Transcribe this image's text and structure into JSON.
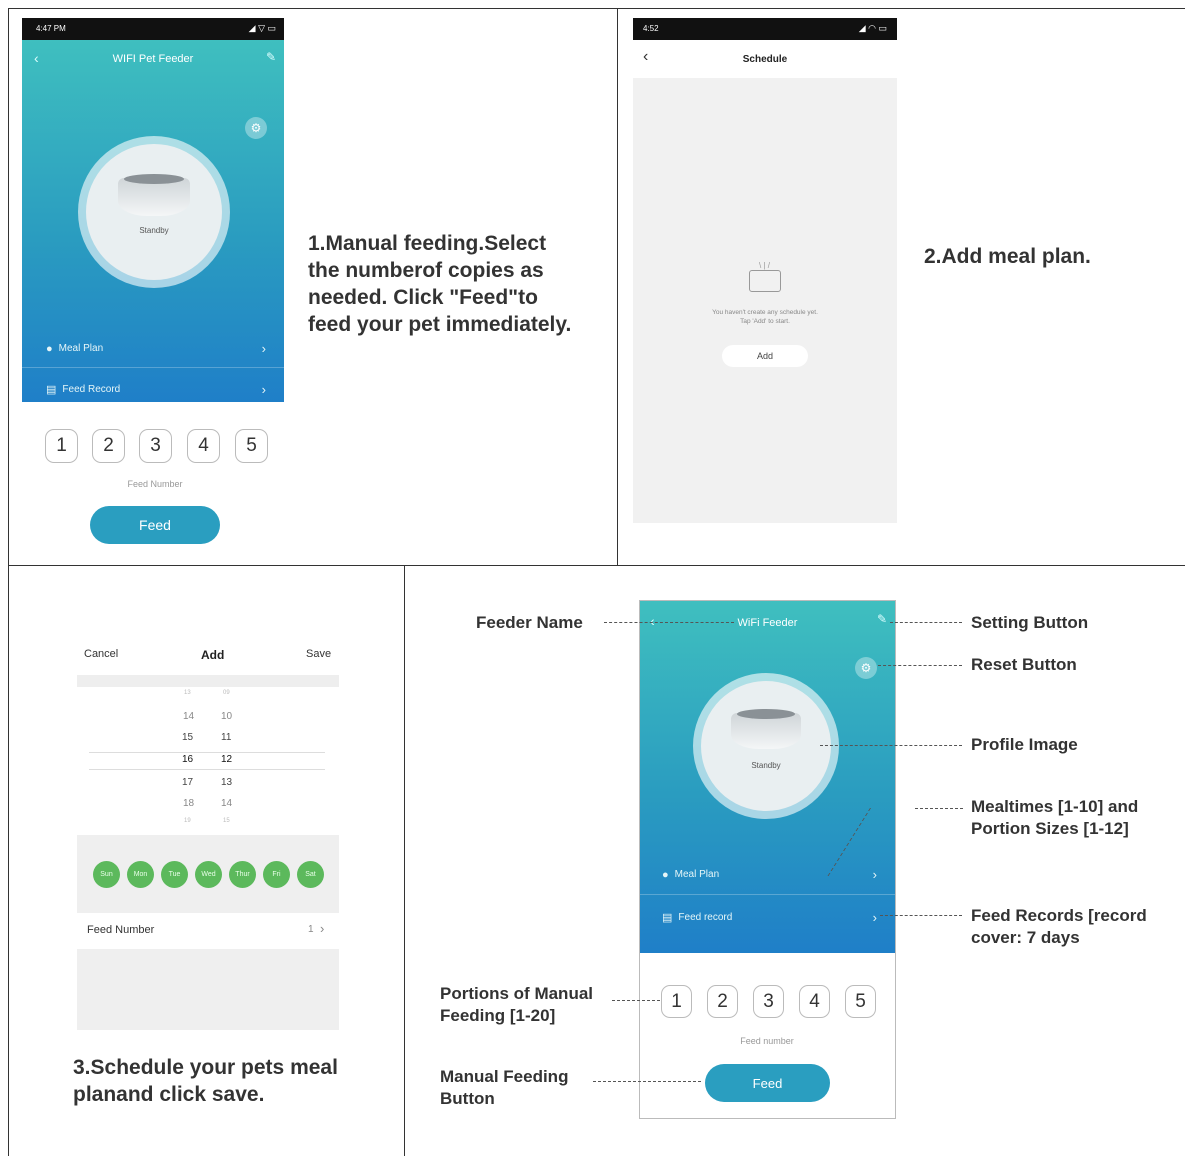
{
  "panel1": {
    "status_time": "4:47 PM",
    "title": "WIFI Pet Feeder",
    "status": "Standby",
    "menu": [
      "Meal Plan",
      "Feed Record"
    ],
    "numbers": [
      "1",
      "2",
      "3",
      "4",
      "5"
    ],
    "feed_number_label": "Feed Number",
    "feed_label": "Feed",
    "caption": [
      "1.Manual feeding.Select",
      "the numberof copies as",
      "needed. Click \"Feed\"to",
      "feed your pet immediately."
    ]
  },
  "panel2": {
    "status_time": "4:52",
    "title": "Schedule",
    "empty_line1": "You haven't create any schedule yet.",
    "empty_line2": "Tap 'Add' to start.",
    "add_label": "Add",
    "caption": "2.Add meal plan."
  },
  "panel3": {
    "cancel": "Cancel",
    "title": "Add",
    "save": "Save",
    "hours": [
      "13",
      "14",
      "15",
      "16",
      "17",
      "18",
      "19"
    ],
    "minutes": [
      "09",
      "10",
      "11",
      "12",
      "13",
      "14",
      "15"
    ],
    "days": [
      "Sun",
      "Mon",
      "Tue",
      "Wed",
      "Thur",
      "Fri",
      "Sat"
    ],
    "feed_number_label": "Feed Number",
    "feed_number_value": "1",
    "caption": [
      "3.Schedule your pets meal",
      "planand click save."
    ]
  },
  "panel4": {
    "title": "WiFi Feeder",
    "status": "Standby",
    "menu": [
      "Meal Plan",
      "Feed record"
    ],
    "numbers": [
      "1",
      "2",
      "3",
      "4",
      "5"
    ],
    "feed_number_label": "Feed number",
    "feed_label": "Feed",
    "annotations": {
      "feeder_name": "Feeder Name",
      "setting_button": "Setting Button",
      "reset_button": "Reset Button",
      "profile_image": "Profile Image",
      "mealtimes": [
        "Mealtimes [1-10] and",
        "Portion Sizes [1-12]"
      ],
      "feed_records": [
        "Feed Records [record",
        "cover: 7 days"
      ],
      "portions": [
        "Portions of Manual",
        "Feeding [1-20]"
      ],
      "manual_button": [
        "Manual Feeding",
        "Button"
      ]
    }
  },
  "colors": {
    "teal_top": "#3fbfbf",
    "teal_bottom": "#1f7fc8",
    "button": "#2a9ec0",
    "day_green": "#5cb95c"
  }
}
